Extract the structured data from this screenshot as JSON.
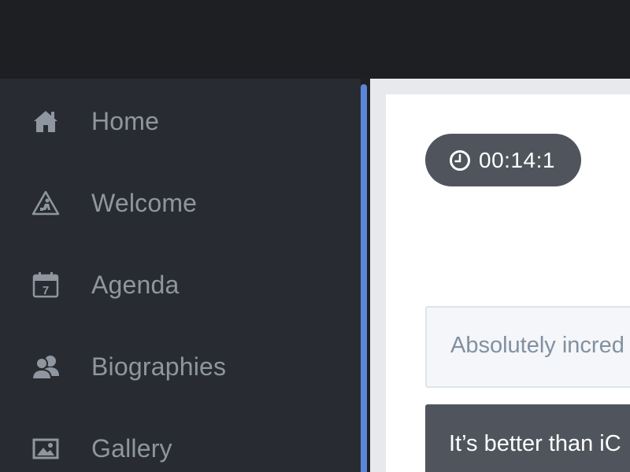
{
  "sidebar": {
    "items": [
      {
        "label": "Home",
        "icon": "home-icon"
      },
      {
        "label": "Welcome",
        "icon": "construction-icon"
      },
      {
        "label": "Agenda",
        "icon": "calendar-icon"
      },
      {
        "label": "Biographies",
        "icon": "people-icon"
      },
      {
        "label": "Gallery",
        "icon": "image-icon"
      }
    ]
  },
  "main": {
    "timer": {
      "icon": "clock-icon",
      "value": "00:14:1"
    },
    "messages": [
      {
        "text": "Absolutely incred"
      },
      {
        "text": "It’s better than iC"
      }
    ]
  },
  "colors": {
    "accent": "#5b86d8",
    "sidebar_bg": "#282c32",
    "topbar_bg": "#1e1f23",
    "nav_text": "#8f96a0",
    "pill_bg": "#50555d"
  }
}
